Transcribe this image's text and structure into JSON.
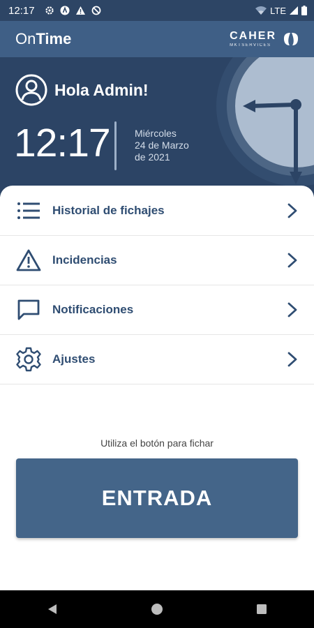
{
  "status_bar": {
    "time": "12:17",
    "network": "LTE"
  },
  "app_bar": {
    "title_part1": "On",
    "title_part2": "Time",
    "brand_name": "CAHER",
    "brand_sub": "MKTSERVICES"
  },
  "header": {
    "greeting": "Hola Admin!",
    "time": "12:17",
    "weekday": "Miércoles",
    "date_line": "24 de Marzo",
    "year_line": "de 2021"
  },
  "menu": [
    {
      "label": "Historial de fichajes",
      "icon": "list-icon"
    },
    {
      "label": "Incidencias",
      "icon": "warning-icon"
    },
    {
      "label": "Notificaciones",
      "icon": "chat-icon"
    },
    {
      "label": "Ajustes",
      "icon": "gear-icon"
    }
  ],
  "hint": "Utiliza el botón para fichar",
  "entrada_label": "ENTRADA",
  "colors": {
    "primary": "#3f5f86",
    "header": "#2c4465",
    "button": "#446589",
    "text_accent": "#2f4d72"
  }
}
